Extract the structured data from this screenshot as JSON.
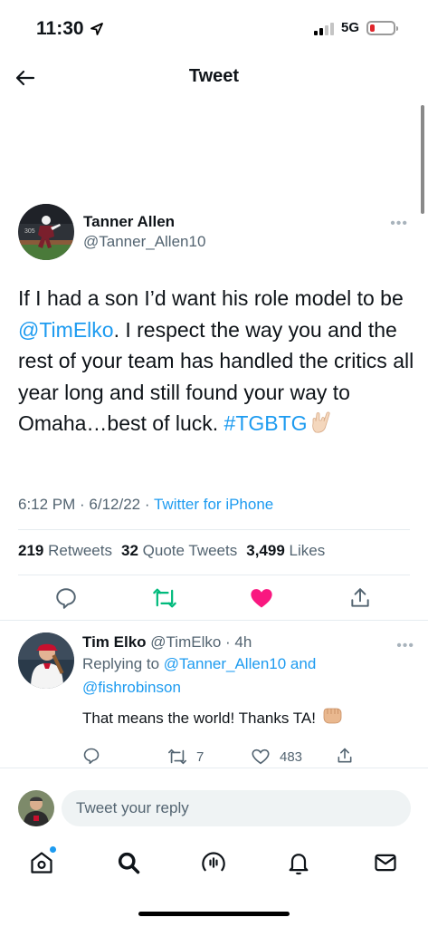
{
  "status_bar": {
    "time": "11:30",
    "network": "5G"
  },
  "header": {
    "title": "Tweet"
  },
  "tweet": {
    "author_name": "Tanner Allen",
    "author_handle": "@Tanner_Allen10",
    "text_part1": "If I had a son I’d want his role model to be ",
    "mention": "@TimElko",
    "text_part2": ". I respect the way you and the rest of your team has handled the critics all year long and still found your way to Omaha…best of luck. ",
    "hashtag": "#TGBTG",
    "time": "6:12 PM",
    "date": "6/12/22",
    "source": "Twitter for iPhone",
    "retweets": "219",
    "retweets_label": "Retweets",
    "quotes": "32",
    "quotes_label": "Quote Tweets",
    "likes": "3,499",
    "likes_label": "Likes",
    "liked": true
  },
  "reply": {
    "author_name": "Tim Elko",
    "author_handle": "@TimElko",
    "time_ago": "4h",
    "replying_to_prefix": "Replying to ",
    "replying_to_user1": "@Tanner_Allen10",
    "replying_to_and": " and",
    "replying_to_user2": "@fishrobinson",
    "text": "That means the world! Thanks TA!",
    "retweet_count": "7",
    "like_count": "483"
  },
  "compose": {
    "placeholder": "Tweet your reply"
  },
  "colors": {
    "accent": "#1d9bf0",
    "like": "#f91880",
    "retweet": "#00ba7c"
  },
  "icons": [
    "back-arrow-icon",
    "more-icon",
    "reply-icon",
    "retweet-icon",
    "heart-icon",
    "share-icon",
    "home-icon",
    "search-icon",
    "spaces-icon",
    "notifications-icon",
    "messages-icon"
  ]
}
